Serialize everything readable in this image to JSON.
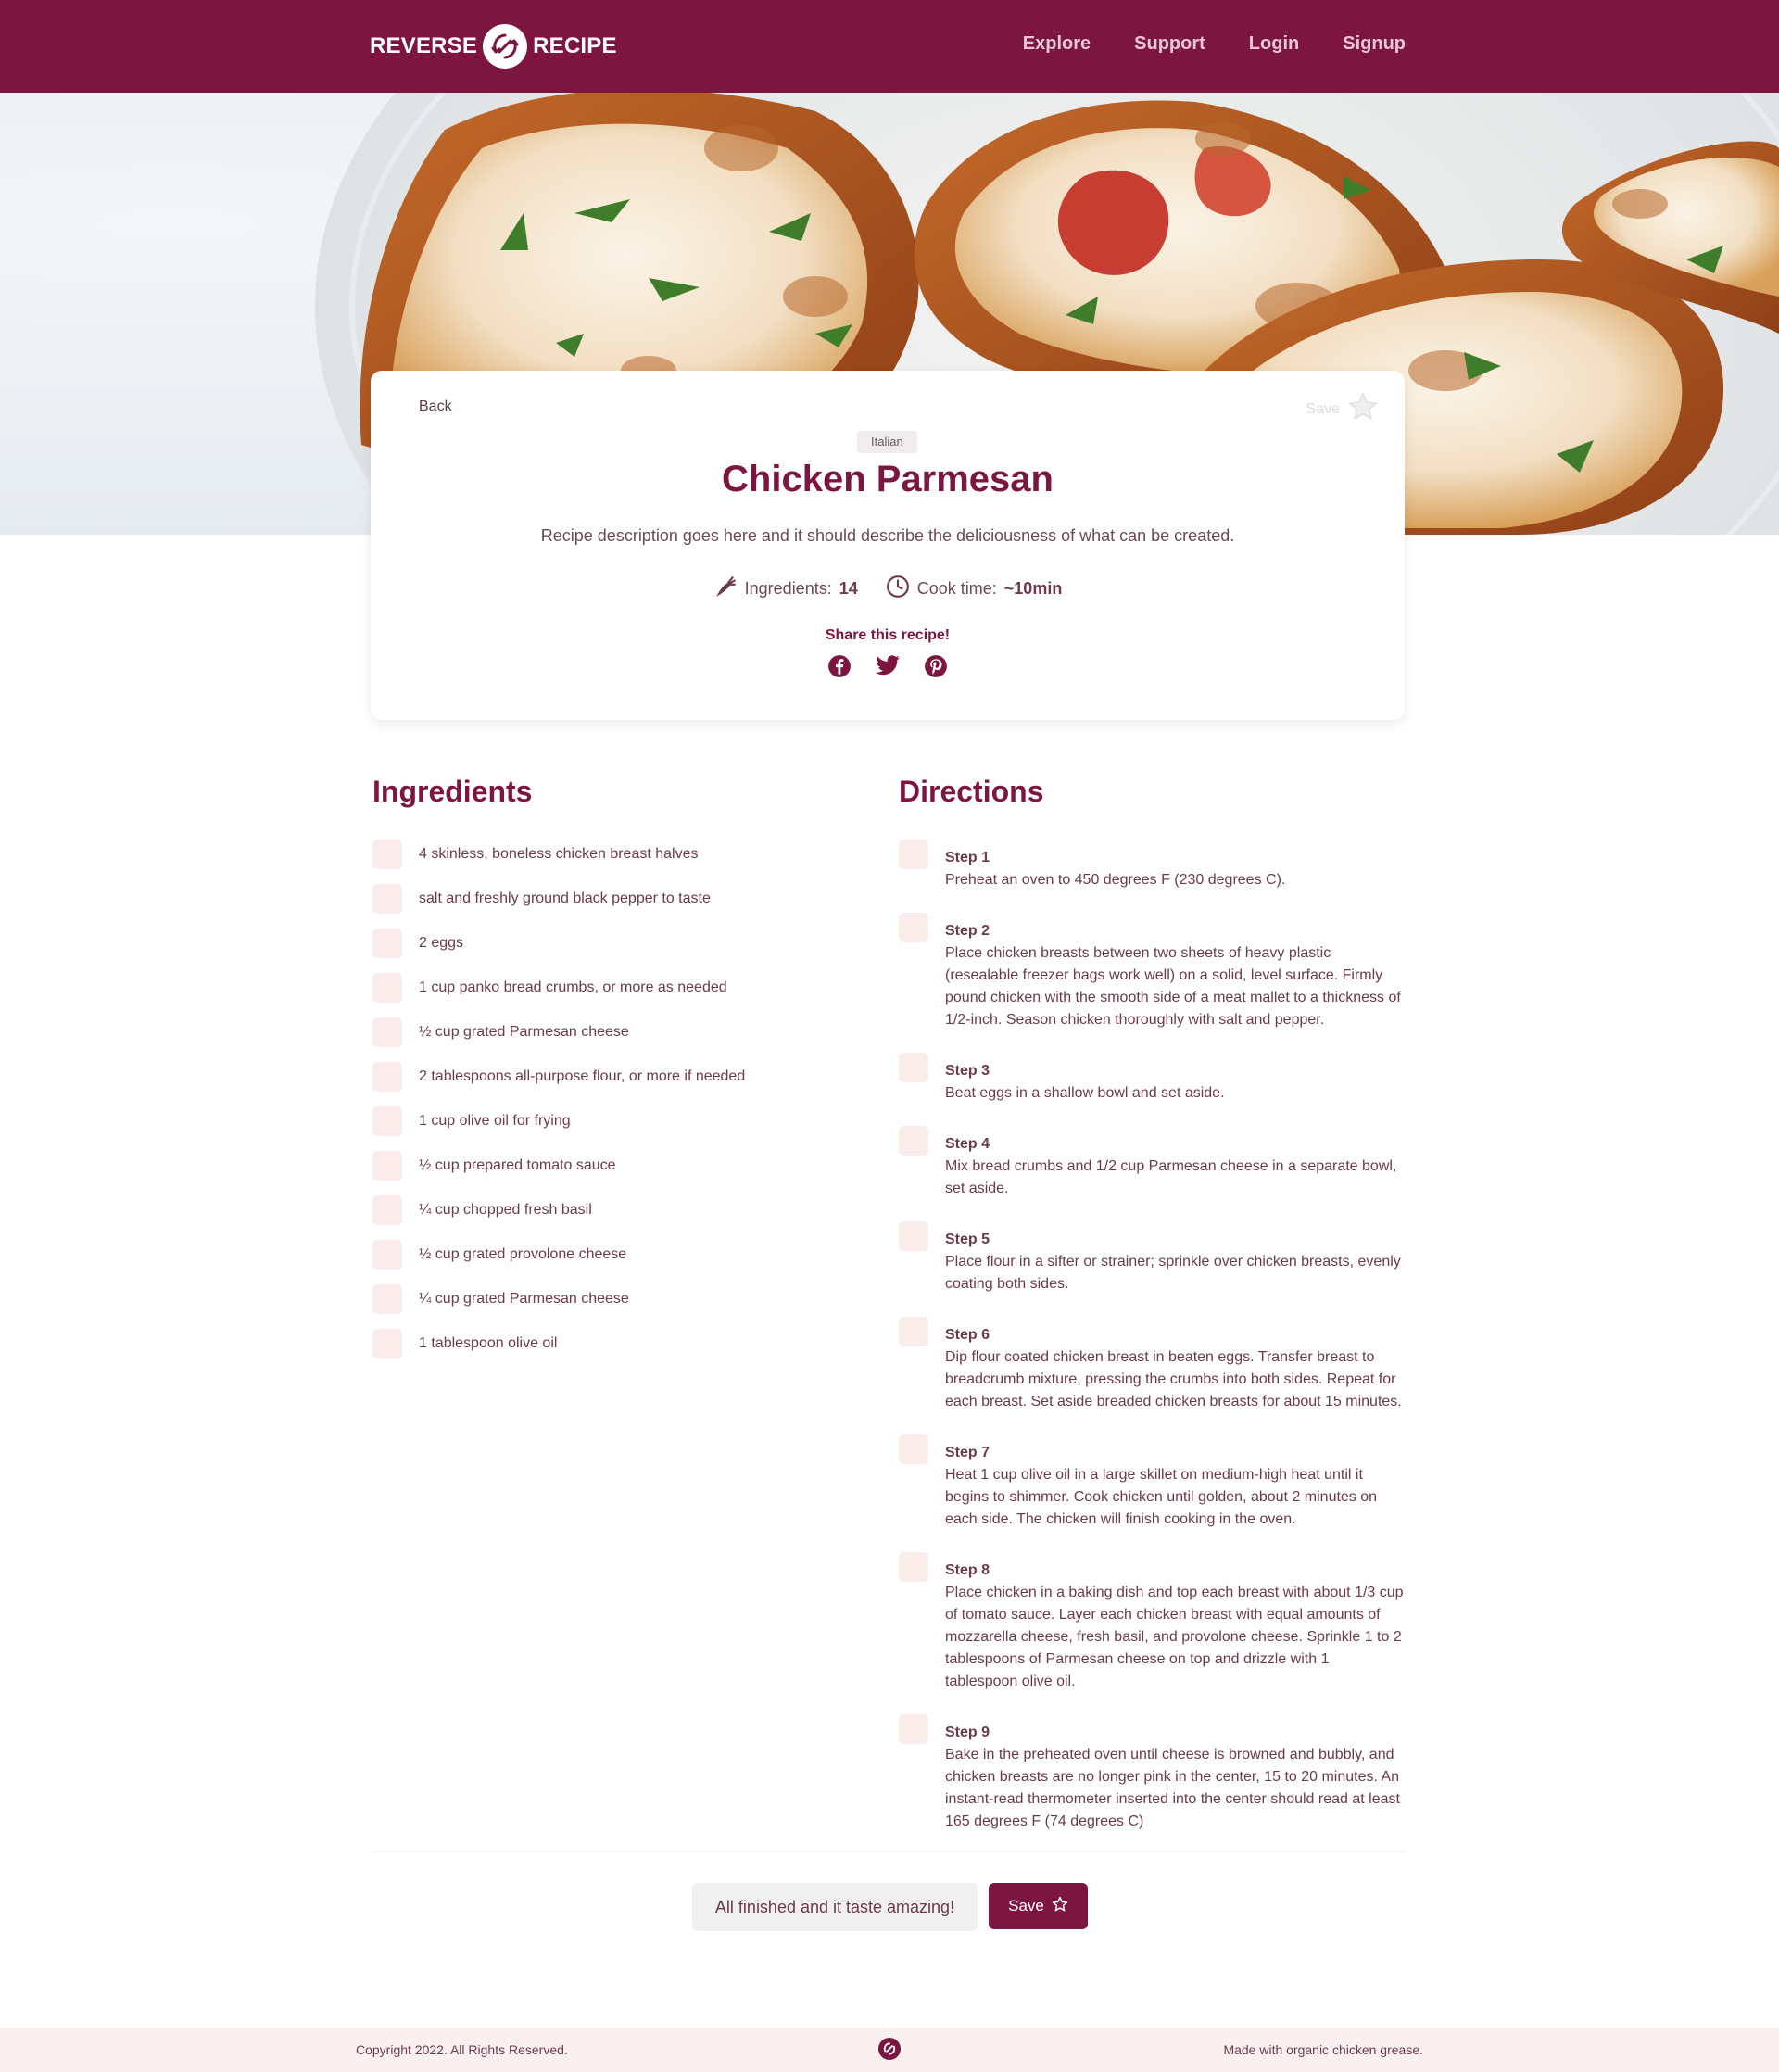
{
  "nav": {
    "logo_left": "REVERSE",
    "logo_right": "RECIPE",
    "links": [
      "Explore",
      "Support",
      "Login",
      "Signup"
    ]
  },
  "recipe": {
    "back_label": "Back",
    "save_label": "Save",
    "cuisine_tag": "Italian",
    "title": "Chicken Parmesan",
    "description": "Recipe description goes here and it should describe the deliciousness of what can be created.",
    "ingredients_label": "Ingredients:",
    "ingredients_count": "14",
    "cook_time_label": "Cook time:",
    "cook_time_value": "~10min",
    "share_label": "Share this recipe!"
  },
  "ingredients": {
    "title": "Ingredients",
    "items": [
      "4 skinless, boneless chicken breast halves",
      "salt and freshly ground black pepper to taste",
      "2 eggs",
      "1 cup panko bread crumbs, or more as needed",
      "½ cup grated Parmesan cheese",
      "2 tablespoons all-purpose flour, or more if needed",
      "1 cup olive oil for frying",
      "½ cup prepared tomato sauce",
      "¼ cup chopped fresh basil",
      "½ cup grated provolone cheese",
      "¼ cup grated Parmesan cheese",
      "1 tablespoon olive oil"
    ]
  },
  "directions": {
    "title": "Directions",
    "steps": [
      {
        "label": "Step 1",
        "text": "Preheat an oven to 450 degrees F (230 degrees C)."
      },
      {
        "label": "Step 2",
        "text": "Place chicken breasts between two sheets of heavy plastic (resealable freezer bags work well) on a solid, level surface. Firmly pound chicken with the smooth side of a meat mallet to a thickness of 1/2-inch. Season chicken thoroughly with salt and pepper."
      },
      {
        "label": "Step 3",
        "text": "Beat eggs in a shallow bowl and set aside."
      },
      {
        "label": "Step 4",
        "text": "Mix bread crumbs and 1/2 cup Parmesan cheese in a separate bowl, set aside."
      },
      {
        "label": "Step 5",
        "text": "Place flour in a sifter or strainer; sprinkle over chicken breasts, evenly coating both sides."
      },
      {
        "label": "Step 6",
        "text": "Dip flour coated chicken breast in beaten eggs. Transfer breast to breadcrumb mixture, pressing the crumbs into both sides. Repeat for each breast. Set aside breaded chicken breasts for about 15 minutes."
      },
      {
        "label": "Step 7",
        "text": "Heat 1 cup olive oil in a large skillet on medium-high heat until it begins to shimmer. Cook chicken until golden, about 2 minutes on each side. The chicken will finish cooking in the oven."
      },
      {
        "label": "Step 8",
        "text": "Place chicken in a baking dish and top each breast with about 1/3 cup of tomato sauce. Layer each chicken breast with equal amounts of mozzarella cheese, fresh basil, and provolone cheese. Sprinkle 1 to 2 tablespoons of Parmesan cheese on top and drizzle with 1 tablespoon olive oil."
      },
      {
        "label": "Step 9",
        "text": "Bake in the preheated oven until cheese is browned and bubbly, and chicken breasts are no longer pink in the center, 15 to 20 minutes. An instant-read thermometer inserted into the center should read at least 165 degrees F (74 degrees C)"
      }
    ]
  },
  "actions": {
    "finished_label": "All finished and it taste amazing!",
    "save_label": "Save"
  },
  "footer": {
    "copyright": "Copyright 2022. All Rights Reserved.",
    "tagline": "Made with organic chicken grease."
  },
  "colors": {
    "brand": "#7c1640",
    "checkbox": "#fbecec",
    "footer_bg": "#fbf0f0"
  },
  "icons": {
    "logo": "reverse-arrows-icon",
    "save": "star-icon",
    "ingredients": "carrot-icon",
    "cook_time": "clock-icon",
    "share": [
      "facebook-icon",
      "twitter-icon",
      "pinterest-icon"
    ]
  }
}
